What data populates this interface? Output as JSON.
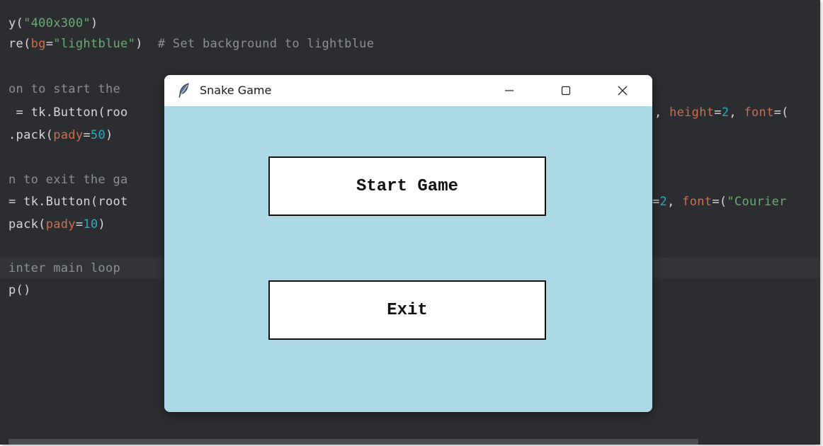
{
  "editor": {
    "lines": {
      "l1": {
        "a": "y(",
        "b": "\"400x300\"",
        "c": ")"
      },
      "l2": {
        "a": "re(",
        "b": "bg",
        "c": "=",
        "d": "\"lightblue\"",
        "e": ")  ",
        "f": "# Set background to lightblue"
      },
      "l3": {
        "a": "on to start the "
      },
      "l4": {
        "a": " = tk.Button(roo"
      },
      "l5": {
        "a": ".pack(",
        "b": "pady",
        "c": "=",
        "d": "50",
        "e": ")"
      },
      "l6": {
        "a": "n to exit the ga"
      },
      "l7": {
        "a": "= tk.Button(root"
      },
      "l8": {
        "a": "pack(",
        "b": "pady",
        "c": "=",
        "d": "10",
        "e": ")"
      },
      "l9": {
        "a": "inter main loop "
      },
      "l10": {
        "a": "p()"
      }
    },
    "right": {
      "r1": {
        "a": ", ",
        "b": "height",
        "c": "=",
        "d": "2",
        "e": ", ",
        "f": "font",
        "g": "=("
      },
      "r2": {
        "a": "=",
        "b": "2",
        "c": ", ",
        "d": "font",
        "e": "=(",
        "f": "\"Courier"
      }
    }
  },
  "window": {
    "title": "Snake Game",
    "controls": {
      "minimize": "—",
      "close": "✕"
    }
  },
  "buttons": {
    "start": "Start Game",
    "exit": "Exit"
  },
  "colors": {
    "editor_bg": "#2b2d30",
    "string": "#6aab73",
    "keyword_arg": "#cf6e4d",
    "number": "#2aacb8",
    "comment": "#8b8f96",
    "window_bg": "#add8e6"
  }
}
